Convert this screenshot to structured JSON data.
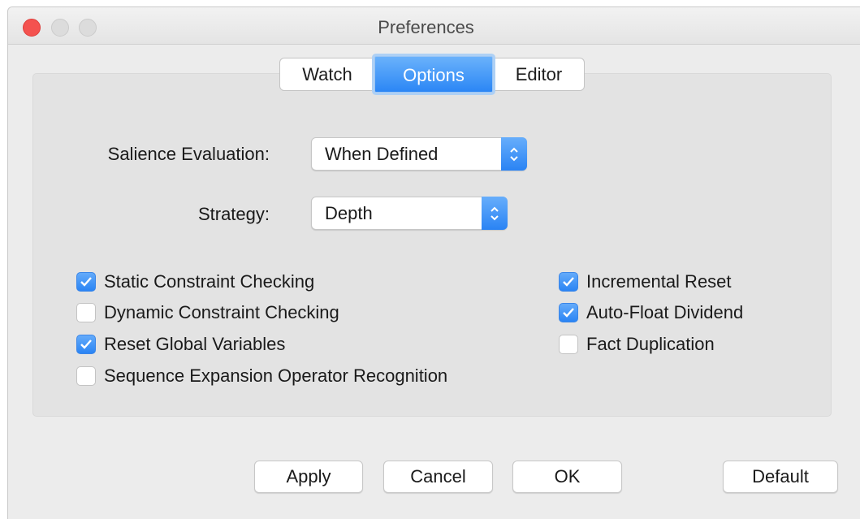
{
  "window": {
    "title": "Preferences",
    "controls": [
      "close",
      "minimize",
      "maximize"
    ]
  },
  "tabs": [
    {
      "label": "Watch",
      "selected": false
    },
    {
      "label": "Options",
      "selected": true
    },
    {
      "label": "Editor",
      "selected": false
    }
  ],
  "settings": {
    "salience": {
      "label": "Salience Evaluation:",
      "value": "When Defined"
    },
    "strategy": {
      "label": "Strategy:",
      "value": "Depth"
    }
  },
  "checkboxes": {
    "left": [
      {
        "label": "Static Constraint Checking",
        "checked": true
      },
      {
        "label": "Dynamic Constraint Checking",
        "checked": false
      },
      {
        "label": "Reset Global Variables",
        "checked": true
      },
      {
        "label": "Sequence Expansion Operator Recognition",
        "checked": false
      }
    ],
    "right": [
      {
        "label": "Incremental Reset",
        "checked": true
      },
      {
        "label": "Auto-Float Dividend",
        "checked": true
      },
      {
        "label": "Fact Duplication",
        "checked": false
      }
    ]
  },
  "buttons": {
    "apply": "Apply",
    "cancel": "Cancel",
    "ok": "OK",
    "default": "Default"
  },
  "colors": {
    "accent": "#2b86f5",
    "close_button": "#f4524f",
    "panel": "#e3e3e3",
    "window": "#ececec"
  }
}
